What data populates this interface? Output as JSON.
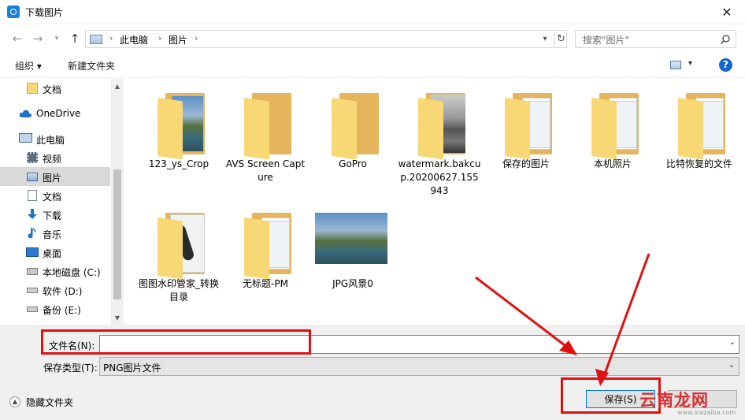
{
  "window": {
    "title": "下载图片",
    "close_glyph": "✕"
  },
  "address": {
    "crumbs": [
      "此电脑",
      "图片"
    ],
    "search_placeholder": "搜索\"图片\""
  },
  "toolbar": {
    "organize": "组织 ▾",
    "new_folder": "新建文件夹",
    "help": "?"
  },
  "nav": {
    "items": [
      {
        "label": "文档",
        "icon": "folder-icon"
      },
      {
        "label": "OneDrive",
        "icon": "cloud-icon"
      },
      {
        "label": "此电脑",
        "icon": "computer-icon"
      },
      {
        "label": "视频",
        "icon": "video-icon"
      },
      {
        "label": "图片",
        "icon": "pictures-icon",
        "selected": true
      },
      {
        "label": "文档",
        "icon": "document-icon"
      },
      {
        "label": "下载",
        "icon": "download-icon"
      },
      {
        "label": "音乐",
        "icon": "music-icon"
      },
      {
        "label": "桌面",
        "icon": "desktop-icon"
      },
      {
        "label": "本地磁盘 (C:)",
        "icon": "drive-c-icon"
      },
      {
        "label": "软件 (D:)",
        "icon": "drive-icon"
      },
      {
        "label": "备份 (E:)",
        "icon": "drive-icon"
      }
    ]
  },
  "files": [
    {
      "label": "123_ys_Crop",
      "type": "folder-with-photo"
    },
    {
      "label": "AVS Screen Capture",
      "type": "folder"
    },
    {
      "label": "GoPro",
      "type": "folder"
    },
    {
      "label": "watermark.bakcup.20200627.155943",
      "type": "folder-with-gray-photo"
    },
    {
      "label": "保存的图片",
      "type": "folder-with-docs"
    },
    {
      "label": "本机照片",
      "type": "folder-with-docs"
    },
    {
      "label": "比特恢复的文件",
      "type": "folder-with-docs"
    },
    {
      "label": "图图水印管家_转换目录",
      "type": "folder-with-earbud"
    },
    {
      "label": "无标题-PM",
      "type": "folder-with-docs"
    },
    {
      "label": "JPG风景0",
      "type": "image"
    }
  ],
  "form": {
    "filename_label": "文件名(N):",
    "filename_value": "",
    "filetype_label": "保存类型(T):",
    "filetype_value": "PNG图片文件"
  },
  "footer": {
    "hide_folders": "隐藏文件夹",
    "save_button": "保存(S)"
  },
  "watermark": {
    "text": "云南龙网",
    "url": "www.xiazaiba.com"
  },
  "colors": {
    "accent": "#0078d7",
    "annotation": "#e01010",
    "selection": "#cce8ff",
    "folder": "#f8d775"
  }
}
